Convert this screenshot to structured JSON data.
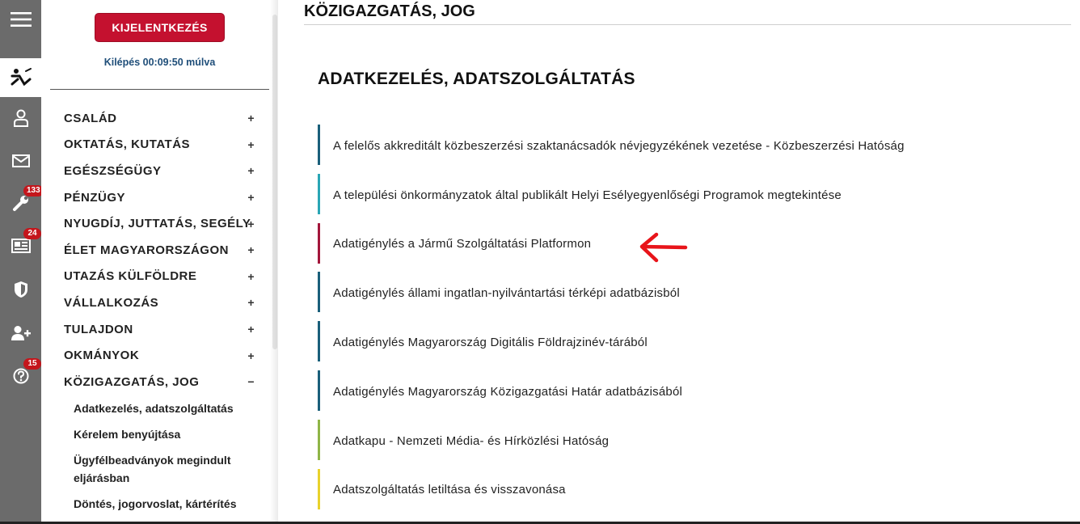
{
  "sidebar": {
    "logout_label": "KIJELENTKEZÉS",
    "timer_text": "Kilépés 00:09:50 múlva",
    "menu": [
      {
        "label": "CSALÁD",
        "sign": "+"
      },
      {
        "label": "OKTATÁS, KUTATÁS",
        "sign": "+"
      },
      {
        "label": "EGÉSZSÉGÜGY",
        "sign": "+"
      },
      {
        "label": "PÉNZÜGY",
        "sign": "+"
      },
      {
        "label": "NYUGDÍJ, JUTTATÁS, SEGÉLY",
        "sign": "+"
      },
      {
        "label": "ÉLET MAGYARORSZÁGON",
        "sign": "+"
      },
      {
        "label": "UTAZÁS KÜLFÖLDRE",
        "sign": "+"
      },
      {
        "label": "VÁLLALKOZÁS",
        "sign": "+"
      },
      {
        "label": "TULAJDON",
        "sign": "+"
      },
      {
        "label": "OKMÁNYOK",
        "sign": "+"
      },
      {
        "label": "KÖZIGAZGATÁS, JOG",
        "sign": "−"
      }
    ],
    "submenu": [
      "Adatkezelés, adatszolgáltatás",
      "Kérelem benyújtása",
      "Ügyfélbeadványok megindult eljárásban",
      "Döntés, jogorvoslat, kártérítés"
    ]
  },
  "rail": {
    "icons": [
      "menu-icon",
      "logo-icon",
      "user-icon",
      "mail-icon",
      "wrench-icon",
      "news-icon",
      "shield-icon",
      "add-user-icon",
      "help-icon"
    ],
    "badges": {
      "wrench": "133",
      "news": "24",
      "help": "15"
    },
    "badge_color": "#c4161c"
  },
  "main": {
    "page_title": "KÖZIGAZGATÁS, JOG",
    "section_title": "ADATKEZELÉS, ADATSZOLGÁLTATÁS",
    "items": [
      {
        "text": "A felelős akkreditált közbeszerzési szaktanácsadók névjegyzékének vezetése - Közbeszerzési Hatóság",
        "color": "#1a5f7a"
      },
      {
        "text": "A települési önkormányzatok által publikált Helyi Esélyegyenlőségi Programok megtekintése",
        "color": "#2aa6b5"
      },
      {
        "text": "Adatigénylés a Jármű Szolgáltatási Platformon",
        "color": "#a3163b"
      },
      {
        "text": "Adatigénylés állami ingatlan-nyilvántartási térképi adatbázisból",
        "color": "#1a5f7a"
      },
      {
        "text": "Adatigénylés Magyarország Digitális Földrajzinév-tárából",
        "color": "#1a5f7a"
      },
      {
        "text": "Adatigénylés Magyarország Közigazgatási Határ adatbázisából",
        "color": "#1a5f7a"
      },
      {
        "text": "Adatkapu - Nemzeti Média- és Hírközlési Hatóság",
        "color": "#8fb547"
      },
      {
        "text": "Adatszolgáltatás letiltása és visszavonása",
        "color": "#e8d22c"
      }
    ],
    "arrow_color": "#e8141a"
  }
}
